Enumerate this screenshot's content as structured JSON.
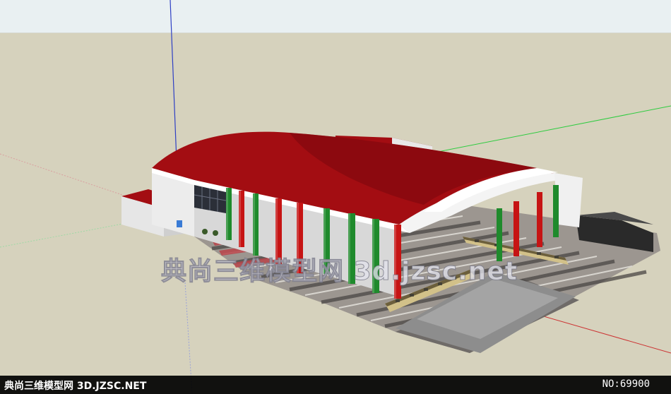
{
  "scene": {
    "description_colors": {
      "sky": "#e9f0f2",
      "ground": "#d6d2bd",
      "roof": "#a30d12",
      "roof_highlight": "#ffffff",
      "column_green": "#1f8a2c",
      "column_red": "#c61414",
      "wall": "#eeeeee",
      "axis_blue": "#2e3fc4",
      "axis_green": "#2ecc40",
      "axis_red": "#cc3333"
    }
  },
  "watermark": {
    "center_text": "典尚三维模型网 3d.jzsc.net",
    "footer_left": "典尚三维模型网 3D.JZSC.NET",
    "footer_right": "NO:69900"
  }
}
